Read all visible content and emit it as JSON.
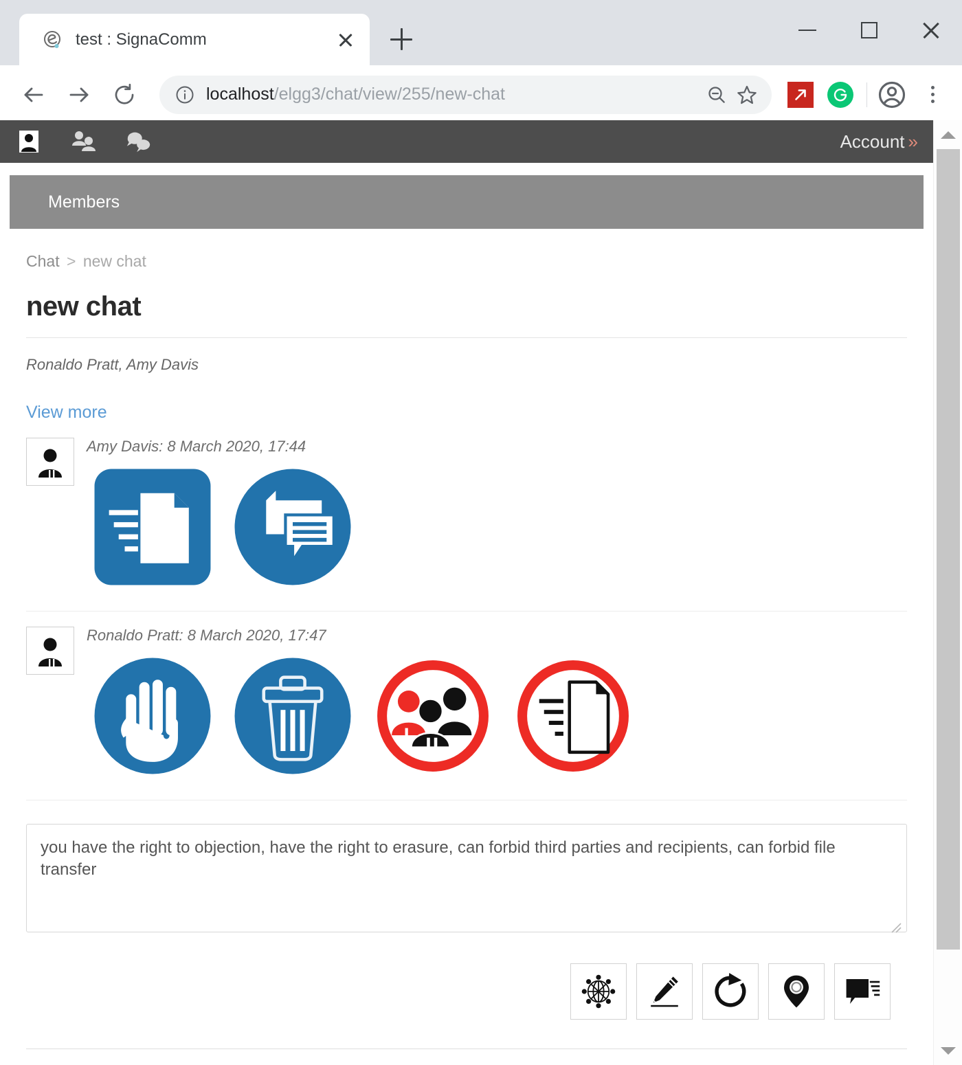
{
  "browser": {
    "tab": {
      "title": "test : SignaComm",
      "favicon_icon": "elgg-favicon",
      "close_icon": "close-icon"
    },
    "new_tab_icon": "plus-icon",
    "window_controls": {
      "minimize_icon": "minimize-icon",
      "maximize_icon": "maximize-icon",
      "close_icon": "window-close-icon"
    },
    "nav": {
      "back_icon": "arrow-left-icon",
      "forward_icon": "arrow-right-icon",
      "reload_icon": "reload-icon"
    },
    "omnibox": {
      "info_icon": "info-circle-icon",
      "url_host": "localhost",
      "url_path": "/elgg3/chat/view/255/new-chat",
      "url_full": "localhost/elgg3/chat/view/255/new-chat",
      "zoom_icon": "zoom-out-icon",
      "bookmark_icon": "star-icon"
    },
    "extensions": [
      {
        "name": "red-arrow-extension-icon",
        "color": "#c8271f"
      },
      {
        "name": "grammarly-extension-icon",
        "color": "#0ac775"
      }
    ],
    "profile_icon": "account-avatar-icon",
    "menu_icon": "kebab-menu-icon"
  },
  "site": {
    "topnav": {
      "icons": [
        {
          "name": "profile-portrait-icon"
        },
        {
          "name": "members-people-icon"
        },
        {
          "name": "chat-bubbles-icon"
        }
      ],
      "account_label": "Account",
      "account_chevron": "»"
    },
    "members_bar": {
      "label": "Members"
    }
  },
  "page": {
    "breadcrumb": {
      "parent": "Chat",
      "separator": ">",
      "current": "new chat"
    },
    "title": "new chat",
    "participants": "Ronaldo Pratt, Amy Davis",
    "view_more_label": "View more",
    "messages": [
      {
        "avatar_icon": "user-avatar-icon",
        "meta": "Amy Davis: 8 March 2020, 17:44",
        "author": "Amy Davis",
        "timestamp": "8 March 2020, 17:44",
        "signals": [
          {
            "name": "file-transfer-allowed-icon",
            "shape": "rounded-square",
            "color": "#2273ac",
            "meaning": "file transfer"
          },
          {
            "name": "chat-recipients-allowed-icon",
            "shape": "circle",
            "color": "#2273ac",
            "meaning": "recipients"
          }
        ]
      },
      {
        "avatar_icon": "user-avatar-icon",
        "meta": "Ronaldo Pratt: 8 March 2020, 17:47",
        "author": "Ronaldo Pratt",
        "timestamp": "8 March 2020, 17:47",
        "signals": [
          {
            "name": "right-to-objection-hand-icon",
            "shape": "circle",
            "color": "#2273ac",
            "meaning": "right to objection"
          },
          {
            "name": "right-to-erasure-trash-icon",
            "shape": "circle",
            "color": "#2273ac",
            "meaning": "right to erasure"
          },
          {
            "name": "forbid-third-parties-icon",
            "shape": "ring",
            "color": "#ed2b25",
            "meaning": "forbid third parties and recipients"
          },
          {
            "name": "forbid-file-transfer-icon",
            "shape": "ring",
            "color": "#ed2b25",
            "meaning": "forbid file transfer"
          }
        ]
      }
    ],
    "composer": {
      "value": "you have the right to objection, have the right to erasure, can forbid third parties and recipients, can forbid file transfer",
      "placeholder": ""
    },
    "action_buttons": [
      {
        "name": "network-globe-button",
        "icon": "network-globe-icon"
      },
      {
        "name": "edit-pencil-button",
        "icon": "pencil-icon"
      },
      {
        "name": "refresh-button",
        "icon": "refresh-circular-arrow-icon"
      },
      {
        "name": "location-pin-button",
        "icon": "location-pin-icon"
      },
      {
        "name": "send-message-button",
        "icon": "send-speech-bubble-icon"
      }
    ]
  },
  "colors": {
    "signal_blue": "#2273ac",
    "signal_red": "#ed2b25",
    "topnav_bg": "#4d4d4d",
    "members_bar_bg": "#8c8c8c",
    "link_blue": "#5b9bd5"
  }
}
